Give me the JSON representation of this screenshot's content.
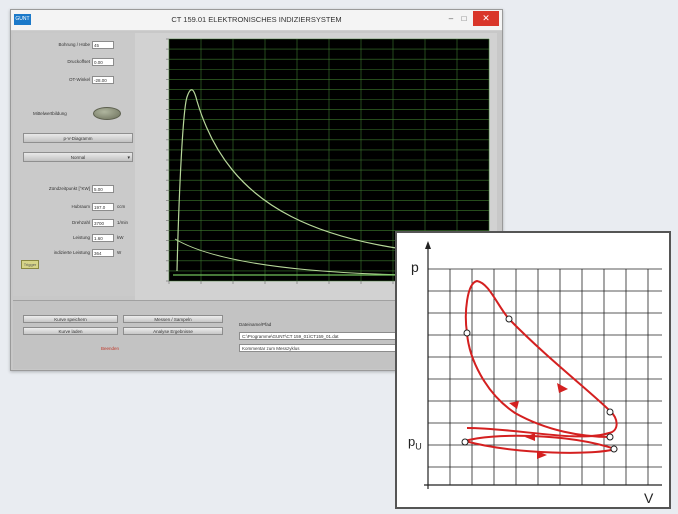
{
  "window": {
    "title": "CT 159.01 ELEKTRONISCHES INDIZIERSYSTEM",
    "logo": "GUNT",
    "controls": {
      "minimize": "–",
      "maximize": "□",
      "close": "✕"
    }
  },
  "left_panel": {
    "fields": [
      {
        "label": "Bohrung / Hübe",
        "value": "45",
        "unit": ""
      },
      {
        "label": "Druckoffset",
        "value": "0.00",
        "unit": ""
      },
      {
        "label": "OT-Winkel",
        "value": "-28.00",
        "unit": ""
      }
    ],
    "toggle_label": "Mittelwertbildung",
    "buttons": {
      "diagram_select": "p-V-Diagramm",
      "mode_select": "Normal"
    },
    "readouts": [
      {
        "label": "Zündzeitpunkt [°KW]",
        "value": "5.00",
        "unit": ""
      },
      {
        "label": "Hubraum",
        "value": "197.0",
        "unit": "ccm"
      },
      {
        "label": "Drehzahl",
        "value": "3700",
        "unit": "1/min"
      },
      {
        "label": "Leistung",
        "value": "1.60",
        "unit": "kW"
      },
      {
        "label": "indizierte Leistung",
        "value": "364",
        "unit": "W"
      }
    ],
    "led_label": "Trigger"
  },
  "bottom_panel": {
    "buttons": {
      "save_curve": "Kurve speichern",
      "load_curve": "Kurve laden",
      "start_measure": "Messen / Sampeln",
      "analysis": "Analyse Ergebnisse"
    },
    "red_label": "Beenden",
    "file_section_label": "Dateiname/Pfad",
    "file_path": "C:\\Programme\\GUNT\\CT 159_01\\CT159_01.dat",
    "file_note": "Kommentar zum Messzyklus"
  },
  "pv_diagram": {
    "y_label": "p",
    "x_label": "V",
    "pu_label": "p",
    "pu_subscript": "U"
  },
  "colors": {
    "plot_background": "#000000",
    "grid": "#3c7a2e",
    "trace": "#b7d79a",
    "cycle": "#d42020",
    "close_button": "#d9362a"
  }
}
